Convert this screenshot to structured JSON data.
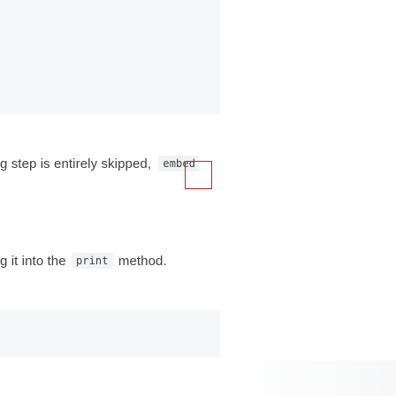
{
  "content": {
    "paragraph1": {
      "text": "g step is entirely skipped, ",
      "inline_code": "embed"
    },
    "paragraph2": {
      "text_before": "g it into the ",
      "inline_code": "print",
      "text_after": " method."
    }
  },
  "colors": {
    "highlight_border": "#c02525",
    "code_block_bg": "#f6f7f8",
    "text": "#3d3f44"
  }
}
